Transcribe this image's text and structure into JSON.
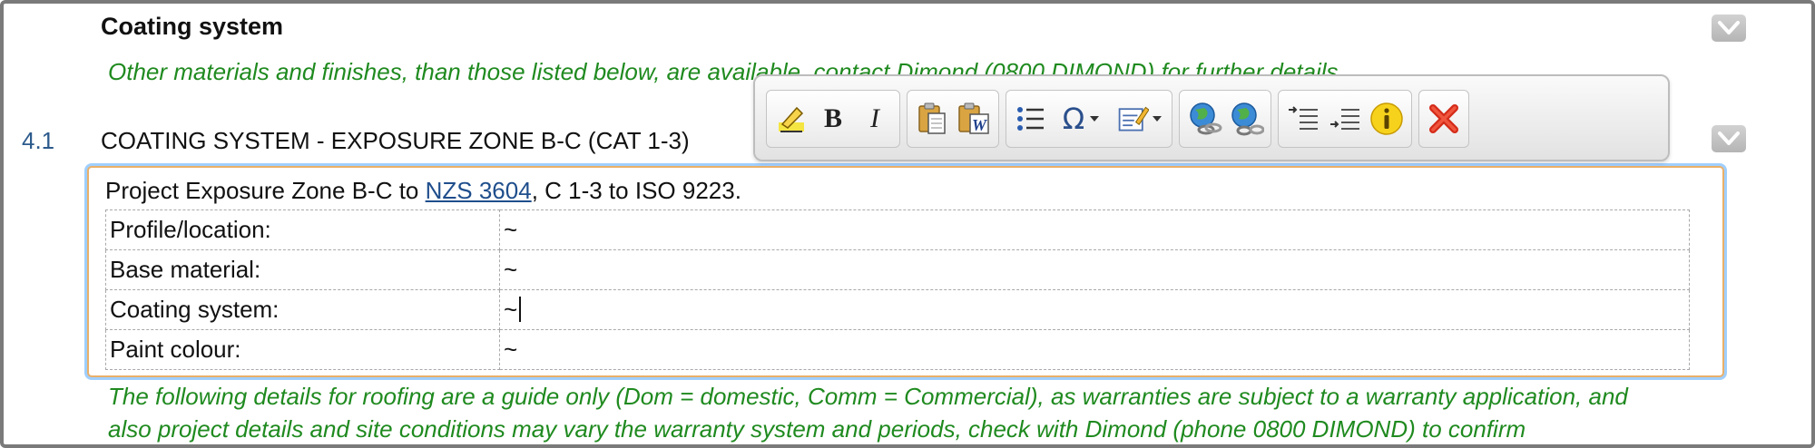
{
  "section": {
    "heading": "Coating system",
    "note": "Other materials and finishes, than those listed below, are available, contact Dimond (0800 DIMOND) for further details."
  },
  "clause": {
    "number": "4.1",
    "title": "COATING SYSTEM - EXPOSURE ZONE B-C (CAT 1-3)"
  },
  "editor": {
    "intro_prefix": "Project Exposure Zone B-C to ",
    "intro_link": "NZS 3604",
    "intro_suffix": ", C 1-3 to ISO 9223.",
    "rows": [
      {
        "label": "Profile/location:",
        "value": "~"
      },
      {
        "label": "Base material:",
        "value": "~"
      },
      {
        "label": "Coating system:",
        "value": "~"
      },
      {
        "label": "Paint colour:",
        "value": "~"
      }
    ]
  },
  "toolbar": {
    "bold_label": "B",
    "italic_label": "I",
    "special_char_label": "Ω"
  },
  "footer_note": {
    "line1": "The following details for roofing are a guide only (Dom = domestic, Comm = Commercial), as warranties are subject to a warranty application, and",
    "line2": "also project details and site conditions may vary the warranty system and periods, check with Dimond (phone 0800 DIMOND) to confirm"
  },
  "colors": {
    "note_green": "#1f8a1f",
    "link_blue": "#1f4e8c",
    "editor_border": "#e9b06a",
    "editor_focus": "#9fcfff"
  }
}
